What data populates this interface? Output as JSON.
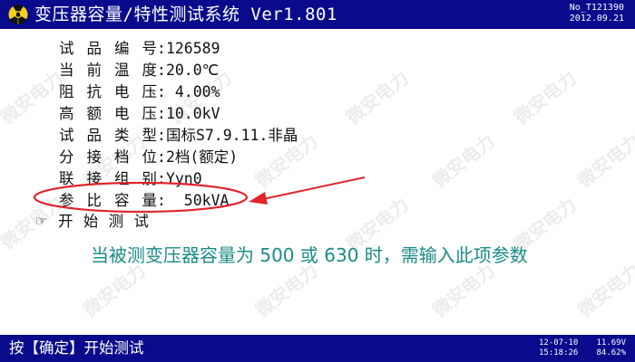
{
  "header": {
    "title": "变压器容量/特性测试系统 Ver1.801",
    "serial": "No_T121390",
    "date": "2012.09.21",
    "icon": "radiation-icon"
  },
  "params": [
    {
      "label": "试品编号",
      "value": "126589"
    },
    {
      "label": "当前温度",
      "value": "20.0℃"
    },
    {
      "label": "阻抗电压",
      "value": " 4.00%"
    },
    {
      "label": "高额电压",
      "value": "10.0kV"
    },
    {
      "label": "试品类型",
      "value": "国标S7.9.11.非晶"
    },
    {
      "label": "分接档位",
      "value": "2档(额定)"
    },
    {
      "label": "联接组别",
      "value": "Yyn0"
    },
    {
      "label": "参比容量",
      "value": "  50kVA"
    }
  ],
  "colon": ":",
  "start": {
    "label": "开始测试",
    "icon": "pointing-hand-icon"
  },
  "annotation": {
    "text": "当被测变压器容量为 500 或 630 时，需输入此项参数",
    "color": "#1a8c86",
    "ellipse_color": "#e0242a",
    "arrow_color": "#e0242a"
  },
  "watermark": "微安电力",
  "footer": {
    "prompt": "按【确定】开始测试",
    "date": "12-07-10",
    "clock": "15:18:26",
    "voltage": "11.69V",
    "battery": "84.62%"
  },
  "colors": {
    "bar": "#0a0a8c",
    "bar_text": "#ffffff",
    "body_text": "#111111",
    "background": "#ffffff"
  }
}
